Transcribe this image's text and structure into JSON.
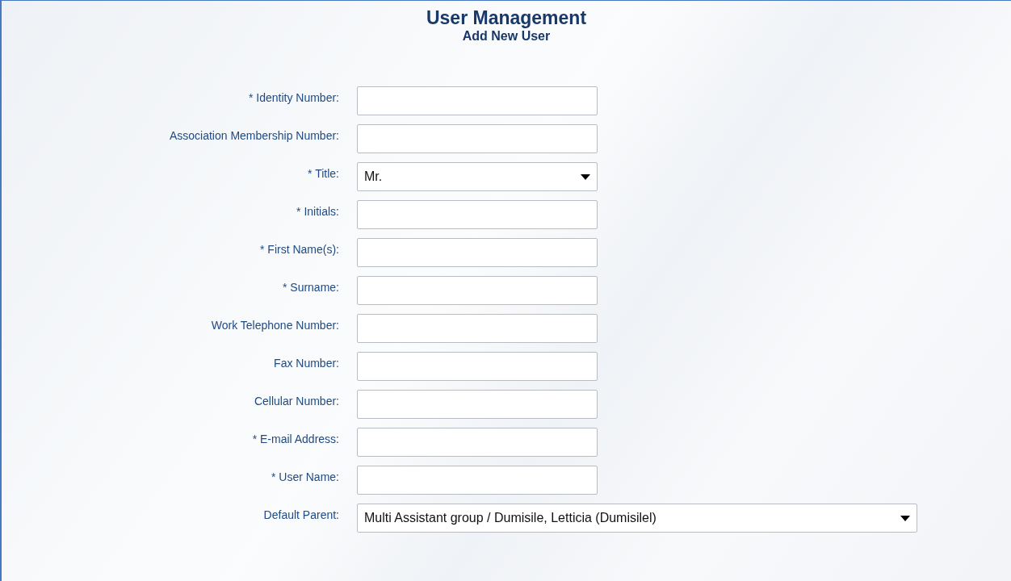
{
  "header": {
    "title": "User Management",
    "subtitle": "Add New User"
  },
  "fields": [
    {
      "label": "* Identity Number:",
      "kind": "text"
    },
    {
      "label": "Association Membership Number:",
      "kind": "text"
    },
    {
      "label": "* Title:",
      "kind": "select",
      "value": "Mr."
    },
    {
      "label": "* Initials:",
      "kind": "text"
    },
    {
      "label": "* First Name(s):",
      "kind": "text"
    },
    {
      "label": "* Surname:",
      "kind": "text"
    },
    {
      "label": "Work Telephone Number:",
      "kind": "text"
    },
    {
      "label": "Fax Number:",
      "kind": "text"
    },
    {
      "label": "Cellular Number:",
      "kind": "text"
    },
    {
      "label": "* E-mail Address:",
      "kind": "text"
    },
    {
      "label": "* User Name:",
      "kind": "text"
    },
    {
      "label": "Default Parent:",
      "kind": "wide-select",
      "value": "Multi Assistant group / Dumisile, Letticia (Dumisilel)"
    }
  ]
}
